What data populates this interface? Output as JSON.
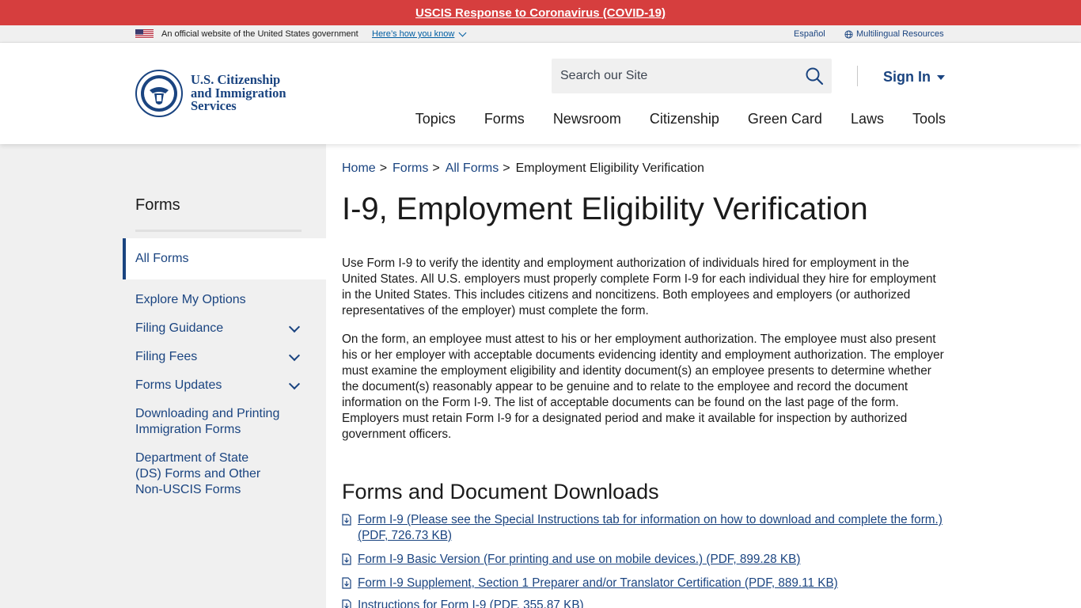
{
  "alert": {
    "text": "USCIS Response to Coronavirus (COVID-19)"
  },
  "gov_banner": {
    "official": "An official website of the United States government",
    "how_know": "Here’s how you know",
    "espanol": "Español",
    "multilingual": "Multilingual Resources"
  },
  "header": {
    "logo_lines": [
      "U.S. Citizenship",
      "and Immigration",
      "Services"
    ],
    "search_placeholder": "Search our Site",
    "sign_in": "Sign In",
    "nav": [
      "Topics",
      "Forms",
      "Newsroom",
      "Citizenship",
      "Green Card",
      "Laws",
      "Tools"
    ]
  },
  "sidebar": {
    "title": "Forms",
    "active": "All Forms",
    "items": [
      {
        "label": "Explore My Options",
        "expandable": false
      },
      {
        "label": "Filing Guidance",
        "expandable": true
      },
      {
        "label": "Filing Fees",
        "expandable": true
      },
      {
        "label": "Forms Updates",
        "expandable": true
      },
      {
        "label": "Downloading and Printing Immigration Forms",
        "expandable": false
      },
      {
        "label": "Department of State (DS) Forms and Other Non-USCIS Forms",
        "expandable": false
      }
    ]
  },
  "breadcrumb": {
    "items": [
      "Home",
      "Forms",
      "All Forms"
    ],
    "current": "Employment Eligibility Verification"
  },
  "page": {
    "title": "I-9, Employment Eligibility Verification",
    "paragraphs": [
      "Use Form I-9 to verify the identity and employment authorization of individuals hired for employment in the United States. All U.S. employers must properly complete Form I-9 for each individual they hire for employment in the United States. This includes citizens and noncitizens. Both employees and employers (or authorized representatives of the employer) must complete the form.",
      "On the form, an employee must attest to his or her employment authorization. The employee must also present his or her employer with acceptable documents evidencing identity and employment authorization. The employer must examine the employment eligibility and identity document(s) an employee presents to determine whether the document(s) reasonably appear to be genuine and to relate to the employee and record the document information on the Form I-9. The list of acceptable documents can be found on the last page of the form. Employers must retain Form I-9 for a designated period and make it available for inspection by authorized government officers."
    ],
    "downloads_title": "Forms and Document Downloads",
    "downloads": [
      "Form I-9 (Please see the Special Instructions tab for information on how to download and complete the form.) (PDF, 726.73 KB)",
      "Form I-9 Basic Version (For printing and use on mobile devices.) (PDF, 899.28 KB)",
      "Form I-9 Supplement, Section 1 Preparer and/or Translator Certification (PDF, 889.11 KB)",
      "Instructions for Form I-9 (PDF, 355.87 KB)"
    ]
  },
  "colors": {
    "alert": "#d63e3e",
    "brand": "#1a4480",
    "sidebar_bg": "#f0f0f0"
  }
}
